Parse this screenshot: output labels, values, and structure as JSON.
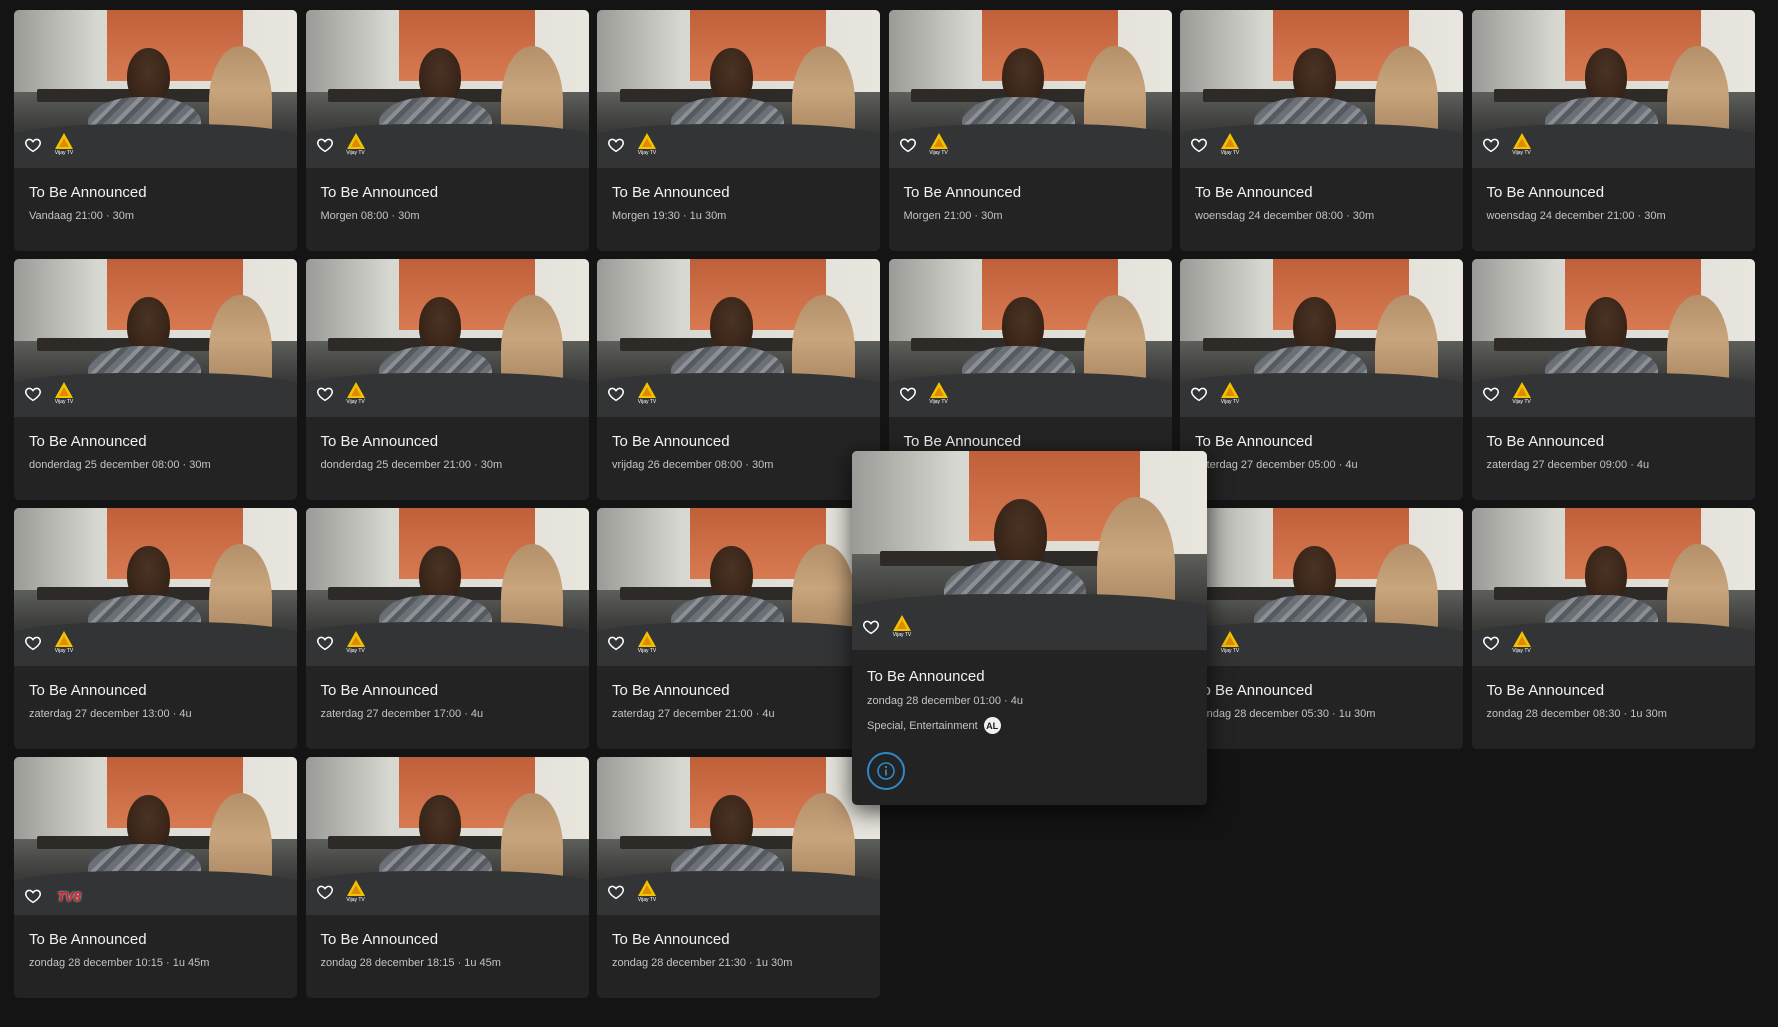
{
  "colors": {
    "background": "#141414",
    "card": "#232323",
    "accent": "#2f89c8"
  },
  "cards": [
    {
      "title": "To Be Announced",
      "meta": "Vandaag 21:00 · 30m",
      "channel": "Vijay TV"
    },
    {
      "title": "To Be Announced",
      "meta": "Morgen 08:00 · 30m",
      "channel": "Vijay TV"
    },
    {
      "title": "To Be Announced",
      "meta": "Morgen 19:30 · 1u 30m",
      "channel": "Vijay TV"
    },
    {
      "title": "To Be Announced",
      "meta": "Morgen 21:00 · 30m",
      "channel": "Vijay TV"
    },
    {
      "title": "To Be Announced",
      "meta": "woensdag 24 december 08:00 · 30m",
      "channel": "Vijay TV"
    },
    {
      "title": "To Be Announced",
      "meta": "woensdag 24 december 21:00 · 30m",
      "channel": "Vijay TV"
    },
    {
      "title": "To Be Announced",
      "meta": "donderdag 25 december 08:00 · 30m",
      "channel": "Vijay TV"
    },
    {
      "title": "To Be Announced",
      "meta": "donderdag 25 december 21:00 · 30m",
      "channel": "Vijay TV"
    },
    {
      "title": "To Be Announced",
      "meta": "vrijdag 26 december 08:00 · 30m",
      "channel": "Vijay TV"
    },
    {
      "title": "To Be Announced",
      "meta": "",
      "channel": "Vijay TV"
    },
    {
      "title": "To Be Announced",
      "meta": "zaterdag 27 december 05:00 · 4u",
      "channel": "Vijay TV"
    },
    {
      "title": "To Be Announced",
      "meta": "zaterdag 27 december 09:00 · 4u",
      "channel": "Vijay TV"
    },
    {
      "title": "To Be Announced",
      "meta": "zaterdag 27 december 13:00 · 4u",
      "channel": "Vijay TV"
    },
    {
      "title": "To Be Announced",
      "meta": "zaterdag 27 december 17:00 · 4u",
      "channel": "Vijay TV"
    },
    {
      "title": "To Be Announced",
      "meta": "zaterdag 27 december 21:00 · 4u",
      "channel": "Vijay TV"
    },
    {
      "title": "To Be Announced",
      "meta": "",
      "channel": "Vijay TV"
    },
    {
      "title": "To Be Announced",
      "meta": "zondag 28 december 05:30 · 1u 30m",
      "channel": "Vijay TV"
    },
    {
      "title": "To Be Announced",
      "meta": "zondag 28 december 08:30 · 1u 30m",
      "channel": "Vijay TV"
    },
    {
      "title": "To Be Announced",
      "meta": "zondag 28 december 10:15 · 1u 45m",
      "channel": "TV8"
    },
    {
      "title": "To Be Announced",
      "meta": "zondag 28 december 18:15 · 1u 45m",
      "channel": "Vijay TV"
    },
    {
      "title": "To Be Announced",
      "meta": "zondag 28 december 21:30 · 1u 30m",
      "channel": "Vijay TV"
    }
  ],
  "channel_captions": {
    "vijay": "Vijay TV",
    "tv8": "TV8"
  },
  "hover_card": {
    "title": "To Be Announced",
    "meta": "zondag 28 december 01:00 · 4u",
    "genres": "Special, Entertainment",
    "rating_badge": "AL",
    "channel": "Vijay TV",
    "info_icon": "info-icon"
  }
}
